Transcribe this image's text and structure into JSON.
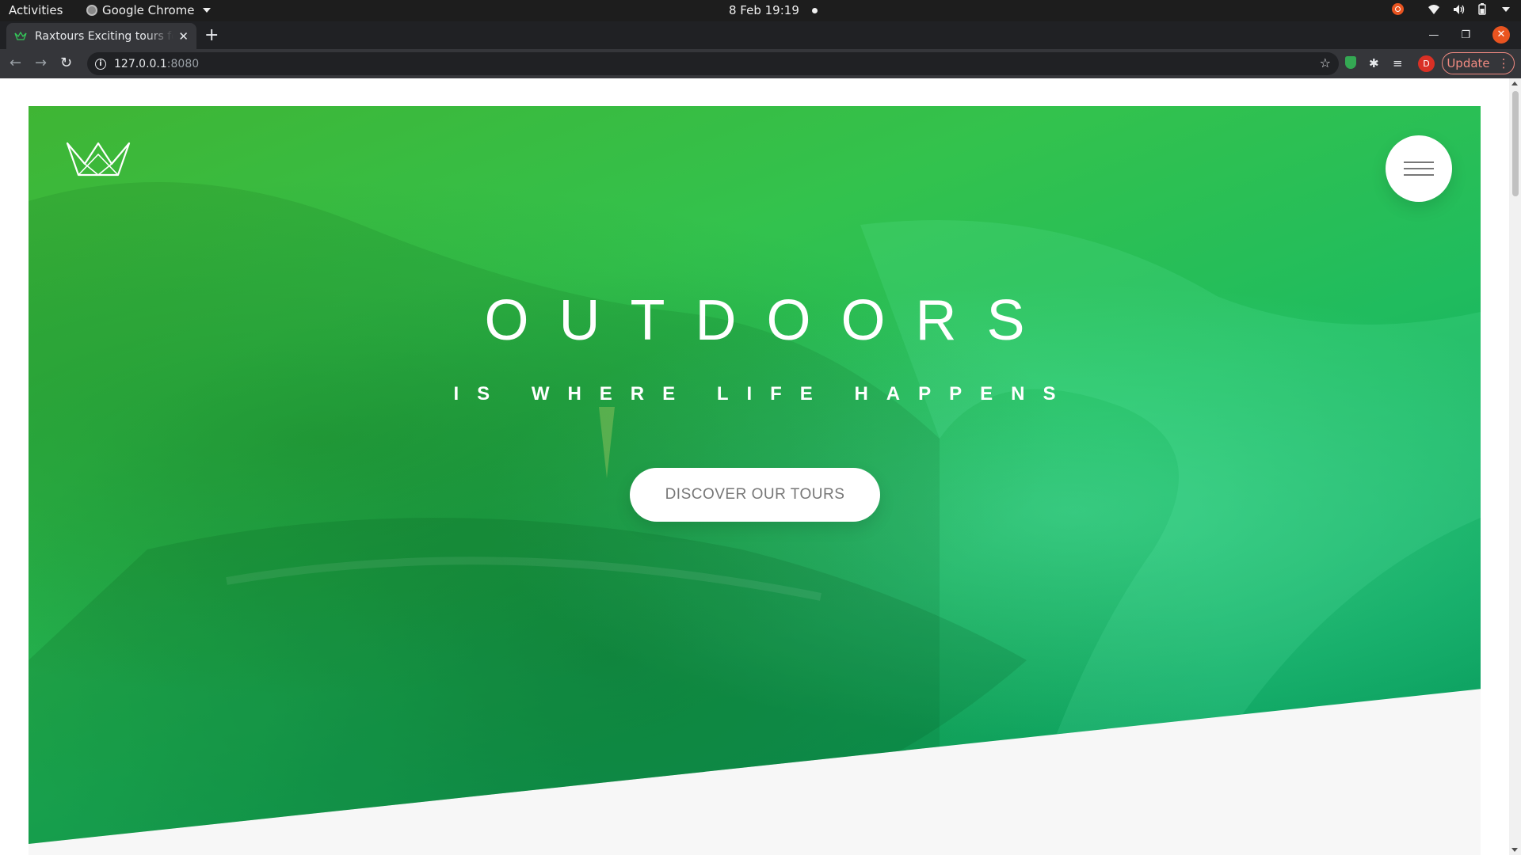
{
  "os": {
    "activities": "Activities",
    "app_name": "Google Chrome",
    "clock": "8 Feb  19:19"
  },
  "browser": {
    "tab_title": "Raxtours Exciting tours for adventurous people",
    "url_host": "127.0.0.1",
    "url_port": ":8080",
    "update_label": "Update",
    "profile_initial": "D"
  },
  "hero": {
    "title": "OUTDOORS",
    "subtitle": "IS WHERE LIFE HAPPENS",
    "cta_label": "DISCOVER OUR TOURS"
  },
  "colors": {
    "hero_gradient_start": "#3fb534",
    "hero_gradient_end": "#0e9c62",
    "below_section": "#f7f7f7"
  }
}
